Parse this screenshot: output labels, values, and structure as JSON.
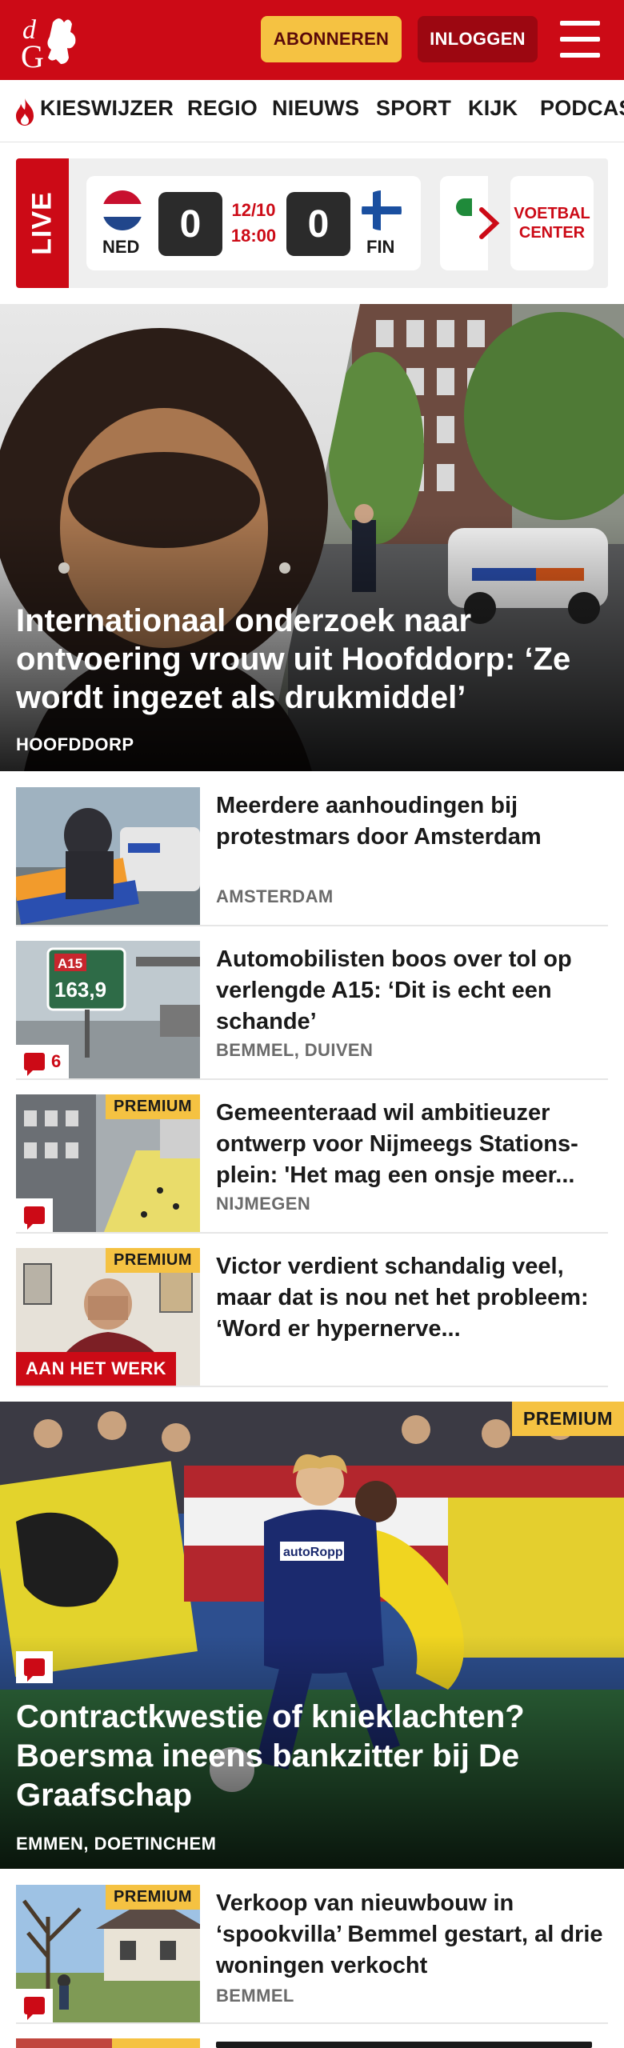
{
  "header": {
    "logo_text": "dG",
    "subscribe_label": "ABONNEREN",
    "login_label": "INLOGGEN",
    "menu_icon": "hamburger-icon"
  },
  "nav": {
    "items": [
      {
        "label": "KIESWIJZER",
        "icon": "flame-icon"
      },
      {
        "label": "REGIO"
      },
      {
        "label": "NIEUWS"
      },
      {
        "label": "SPORT"
      },
      {
        "label": "KIJK"
      },
      {
        "label": "PODCAS"
      }
    ]
  },
  "live": {
    "label": "LIVE",
    "match": {
      "home_code": "NED",
      "home_score": "0",
      "away_code": "FIN",
      "away_score": "0",
      "date": "12/10",
      "time": "18:00"
    },
    "voetbal_center": "VOETBAL CENTER",
    "next_icon": "chevron-right-icon"
  },
  "hero": {
    "title": "Internationaal onderzoek naar ontvoering vrouw uit Hoofddorp: ‘Ze wordt ingezet als drukmiddel’",
    "location": "HOOFDDORP"
  },
  "articles": [
    {
      "title": "Meerdere aanhoudingen bij protestmars door Amsterdam",
      "location": "AMSTERDAM"
    },
    {
      "title": "Automobilisten boos over tol op verlengde A15: ‘Dit is echt een schande’",
      "location": "BEMMEL, DUIVEN",
      "comments": "6",
      "sign_top": "A15",
      "sign_bottom": "163,9"
    },
    {
      "title": "Gemeenteraad wil ambitieuzer ontwerp voor Nijmeegs Stations-plein: 'Het mag een onsje meer...",
      "location": "NIJMEGEN",
      "premium": "PREMIUM"
    },
    {
      "title": "Victor verdient schandalig veel, maar dat is nou net het probleem: ‘Word er hypernerve...",
      "premium": "PREMIUM",
      "section_label": "AAN HET WERK"
    }
  ],
  "feature": {
    "title": "Contractkwestie of knieklachten? Boersma ineens bankzitter bij De Graafschap",
    "location": "EMMEN, DOETINCHEM",
    "premium": "PREMIUM",
    "jersey_text": "autoRopp"
  },
  "articles2": [
    {
      "title": "Verkoop van nieuwbouw in ‘spookvilla’ Bemmel gestart, al drie woningen verkocht",
      "location": "BEMMEL",
      "premium": "PREMIUM"
    }
  ],
  "colors": {
    "brand_red": "#cc0a16",
    "premium_yellow": "#f5c242",
    "login_dark_red": "#9c0711"
  }
}
